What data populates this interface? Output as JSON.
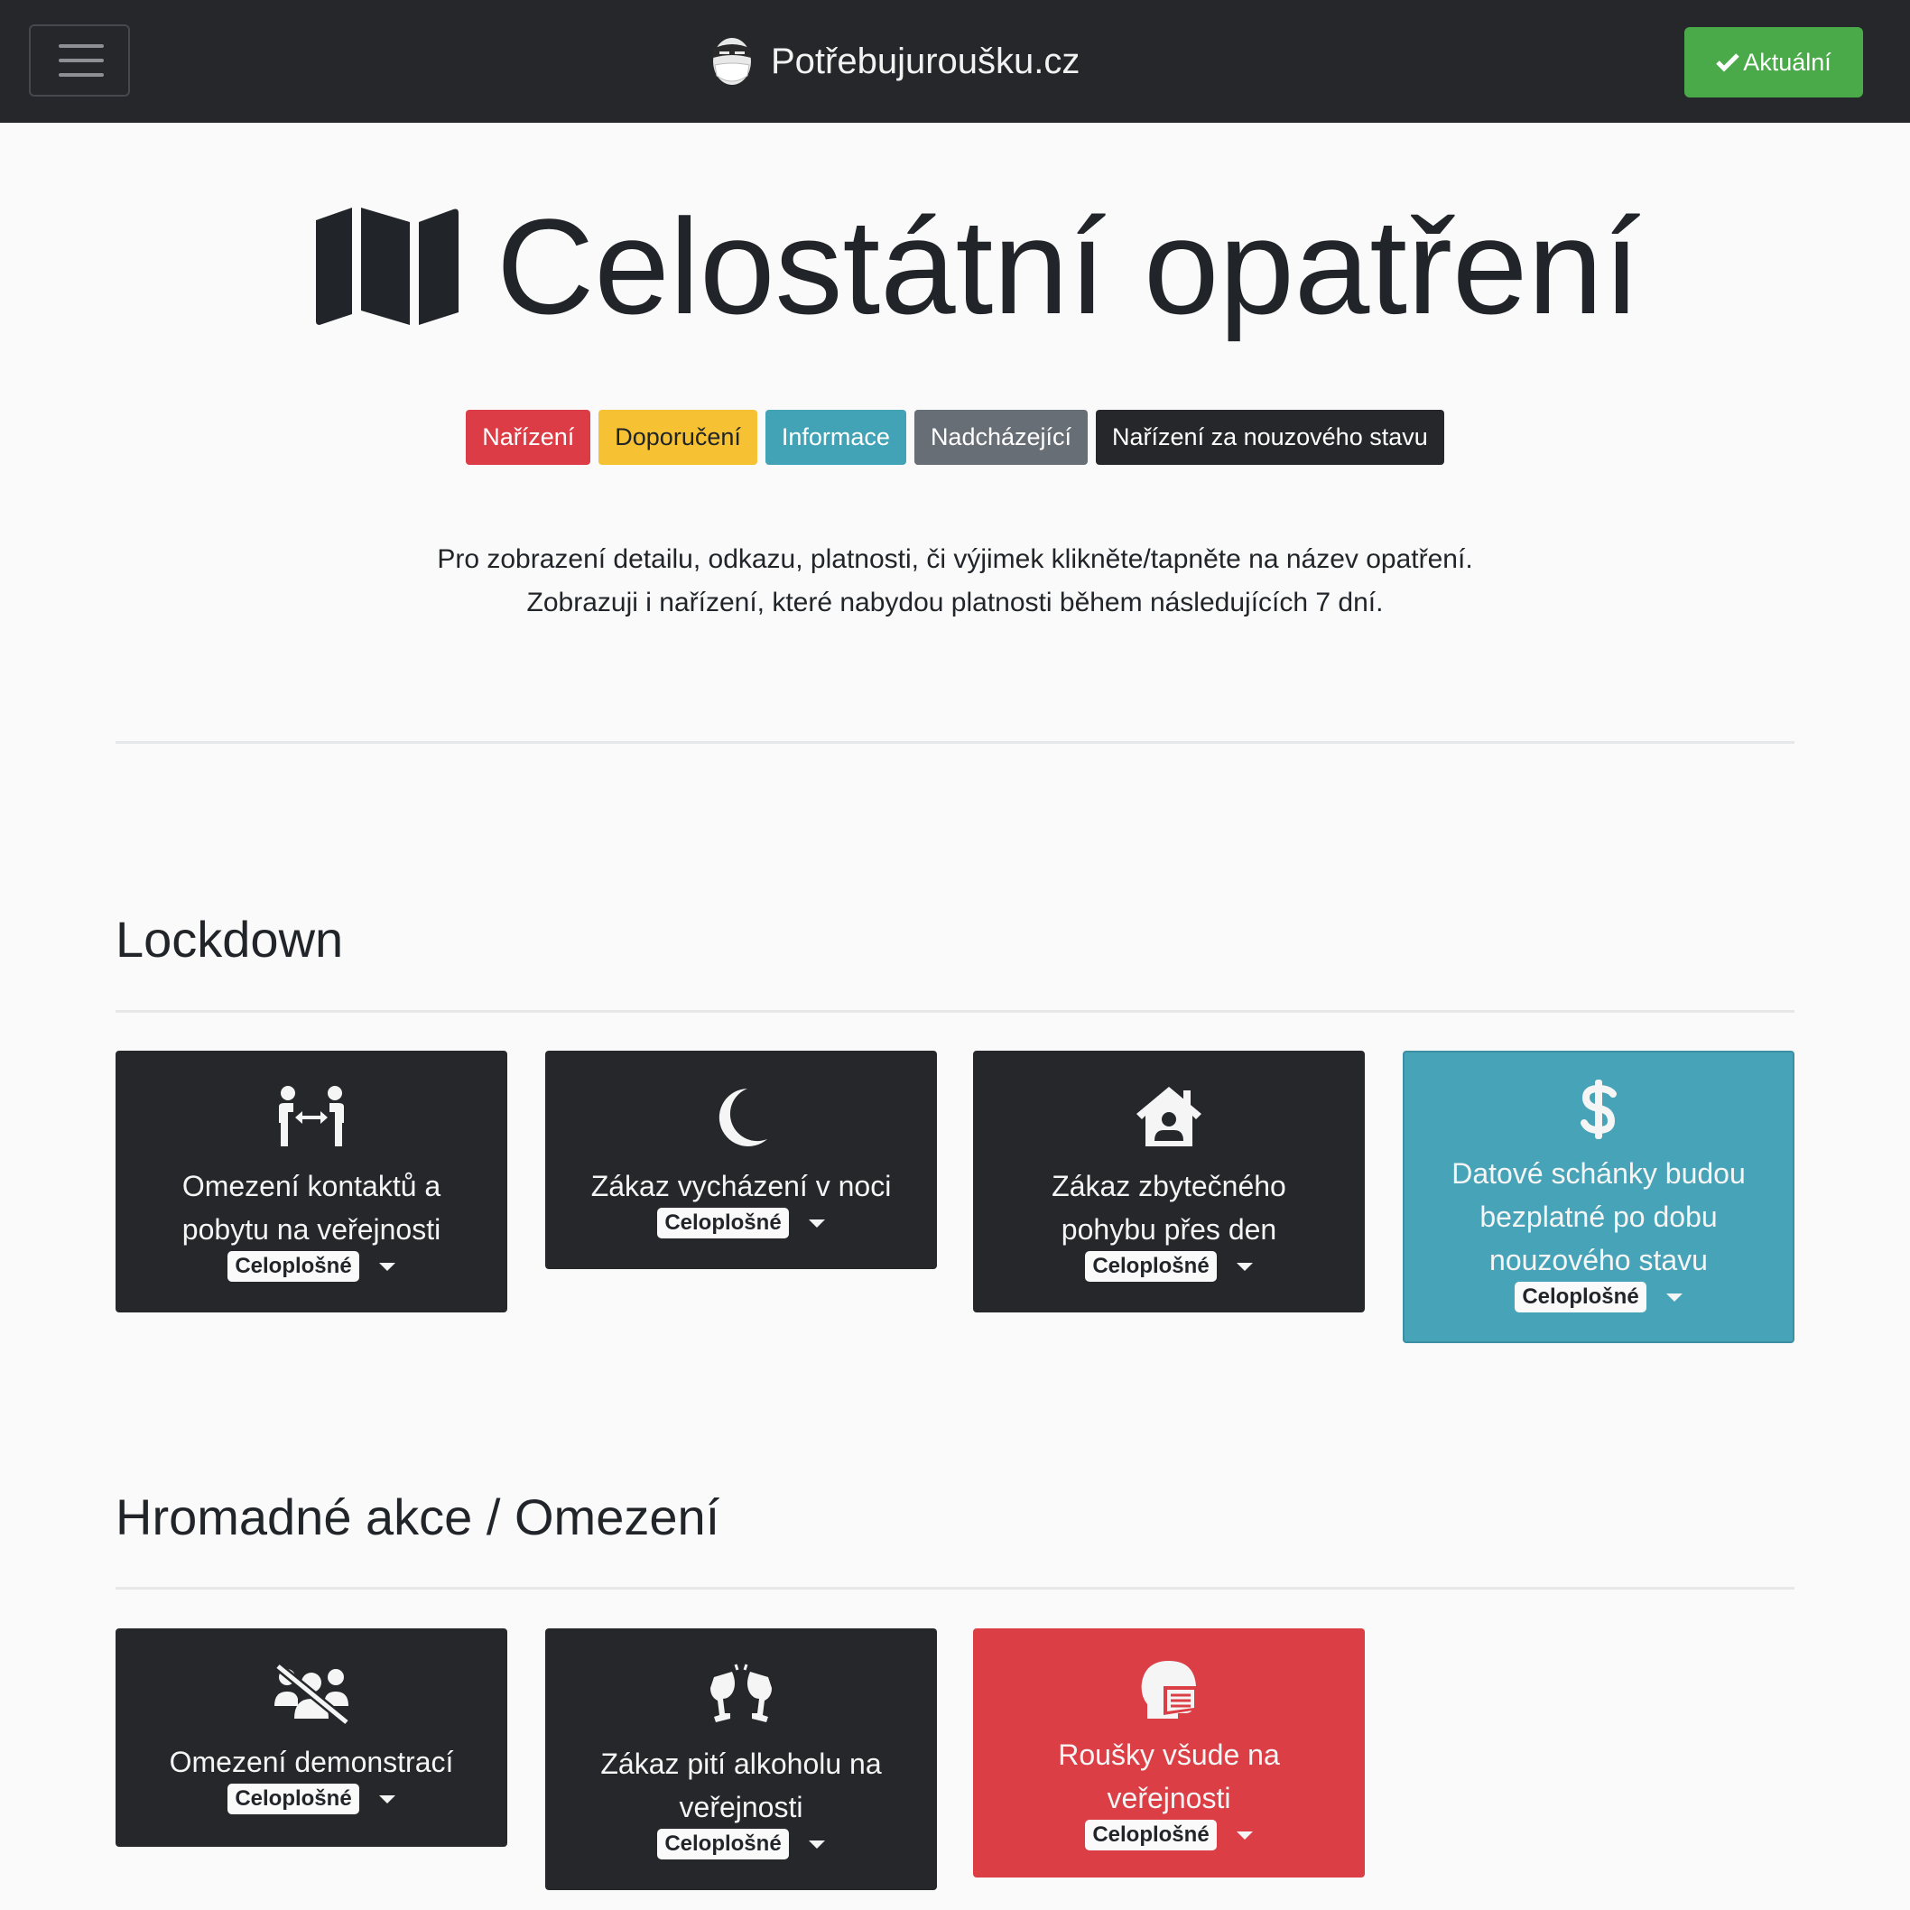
{
  "nav": {
    "brand": "Potřebujuroušku.cz",
    "current_button": "Aktuální"
  },
  "header": {
    "title": "Celostátní opatření",
    "legend": {
      "order": "Nařízení",
      "recommendation": "Doporučení",
      "information": "Informace",
      "upcoming": "Nadcházející",
      "emergency": "Nařízení za nouzového stavu"
    },
    "intro_line1": "Pro zobrazení detailu, odkazu, platnosti, či výjimek klikněte/tapněte na název opatření.",
    "intro_line2": "Zobrazuji i nařízení, které nabydou platnosti během následujících 7 dní."
  },
  "colors": {
    "navbar": "#25272a",
    "current_button": "#4aa948",
    "order": "#dc3c45",
    "recommendation": "#f6c132",
    "information": "#42a3b6",
    "upcoming": "#686e75",
    "emergency": "#25272a"
  },
  "sections": {
    "lockdown": {
      "title": "Lockdown",
      "cards": [
        {
          "icon": "people-arrows-icon",
          "title_line1": "Omezení kontaktů a",
          "title_line2": "pobytu na veřejnosti",
          "scope": "Celoplošné"
        },
        {
          "icon": "moon-icon",
          "title_line1": "Zákaz vycházení v noci",
          "scope": "Celoplošné"
        },
        {
          "icon": "house-user-icon",
          "title_line1": "Zákaz zbytečného",
          "title_line2": "pohybu přes den",
          "scope": "Celoplošné"
        },
        {
          "icon": "dollar-sign-icon",
          "title_line1": "Datové schánky budou",
          "title_line2": "bezplatné po dobu",
          "title_line3": "nouzového stavu",
          "scope": "Celoplošné"
        }
      ]
    },
    "events": {
      "title": "Hromadné akce / Omezení",
      "cards": [
        {
          "icon": "users-slash-icon",
          "title_line1": "Omezení demonstrací",
          "scope": "Celoplošné"
        },
        {
          "icon": "glass-cheers-icon",
          "title_line1": "Zákaz pití alkoholu na",
          "title_line2": "veřejnosti",
          "scope": "Celoplošné"
        },
        {
          "icon": "head-mask-icon",
          "title_line1": "Roušky všude na",
          "title_line2": "veřejnosti",
          "scope": "Celoplošné"
        }
      ]
    }
  }
}
